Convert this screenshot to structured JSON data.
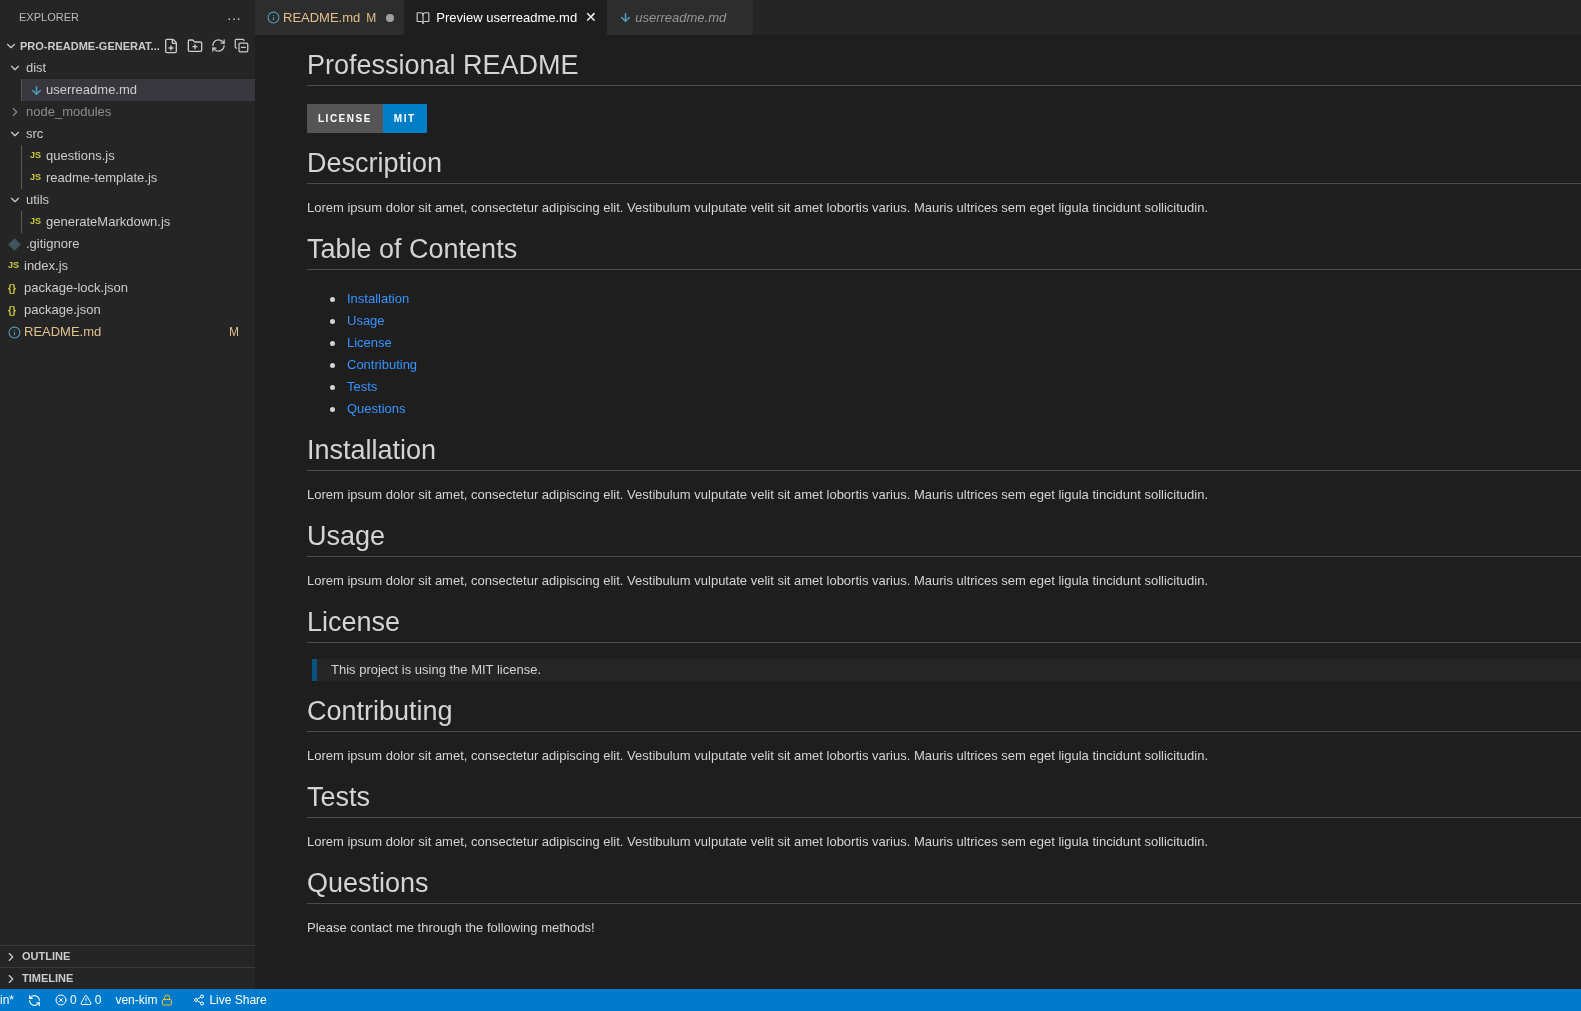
{
  "sidebar": {
    "title": "EXPLORER",
    "menu": "···",
    "root": {
      "label": "PRO-README-GENERAT...",
      "expanded": true
    },
    "tree": [
      {
        "label": "dist",
        "kind": "folder",
        "expanded": true,
        "children": [
          {
            "label": "userreadme.md",
            "kind": "md",
            "selected": true
          }
        ]
      },
      {
        "label": "node_modules",
        "kind": "folder",
        "expanded": false,
        "ignored": true
      },
      {
        "label": "src",
        "kind": "folder",
        "expanded": true,
        "children": [
          {
            "label": "questions.js",
            "kind": "js",
            "icon": "JS",
            "selected": false
          },
          {
            "label": "readme-template.js",
            "kind": "js",
            "icon": "JS",
            "selected": false
          }
        ]
      },
      {
        "label": "utils",
        "kind": "folder",
        "expanded": true,
        "children": [
          {
            "label": "generateMarkdown.js",
            "kind": "js",
            "icon": "JS",
            "selected": false
          }
        ]
      },
      {
        "label": ".gitignore",
        "kind": "git",
        "selected": false
      },
      {
        "label": "index.js",
        "kind": "js",
        "icon": "JS",
        "selected": false
      },
      {
        "label": "package-lock.json",
        "kind": "json",
        "icon": "{}",
        "selected": false
      },
      {
        "label": "package.json",
        "kind": "json",
        "icon": "{}",
        "selected": false
      },
      {
        "label": "README.md",
        "kind": "info",
        "selected": false,
        "badge": "M"
      }
    ],
    "panels": [
      {
        "label": "OUTLINE",
        "expanded": false
      },
      {
        "label": "TIMELINE",
        "expanded": false
      }
    ]
  },
  "tabs": [
    {
      "label": "README.md",
      "kind": "info",
      "badge": "M",
      "dirty": true,
      "italic": false,
      "selected": false
    },
    {
      "label": "Preview userreadme.md",
      "kind": "preview",
      "close": "✕",
      "dirty": false,
      "italic": false,
      "selected": true
    },
    {
      "label": "userreadme.md",
      "kind": "md",
      "dirty": false,
      "italic": true,
      "selected": false
    }
  ],
  "preview": {
    "title": "Professional README",
    "badge": {
      "label": "LICENSE",
      "value": "MIT"
    },
    "sections": [
      {
        "heading": "Description",
        "kind": "paragraph",
        "text": "Lorem ipsum dolor sit amet, consectetur adipiscing elit. Vestibulum vulputate velit sit amet lobortis varius. Mauris ultrices sem eget ligula tincidunt sollicitudin."
      },
      {
        "heading": "Table of Contents",
        "kind": "links",
        "items": [
          "Installation",
          "Usage",
          "License",
          "Contributing",
          "Tests",
          "Questions"
        ]
      },
      {
        "heading": "Installation",
        "kind": "paragraph",
        "text": "Lorem ipsum dolor sit amet, consectetur adipiscing elit. Vestibulum vulputate velit sit amet lobortis varius. Mauris ultrices sem eget ligula tincidunt sollicitudin."
      },
      {
        "heading": "Usage",
        "kind": "paragraph",
        "text": "Lorem ipsum dolor sit amet, consectetur adipiscing elit. Vestibulum vulputate velit sit amet lobortis varius. Mauris ultrices sem eget ligula tincidunt sollicitudin."
      },
      {
        "heading": "License",
        "kind": "quote",
        "text": "This project is using the MIT license."
      },
      {
        "heading": "Contributing",
        "kind": "paragraph",
        "text": "Lorem ipsum dolor sit amet, consectetur adipiscing elit. Vestibulum vulputate velit sit amet lobortis varius. Mauris ultrices sem eget ligula tincidunt sollicitudin."
      },
      {
        "heading": "Tests",
        "kind": "paragraph",
        "text": "Lorem ipsum dolor sit amet, consectetur adipiscing elit. Vestibulum vulputate velit sit amet lobortis varius. Mauris ultrices sem eget ligula tincidunt sollicitudin."
      },
      {
        "heading": "Questions",
        "kind": "paragraph",
        "text": "Please contact me through the following methods!"
      }
    ]
  },
  "status_bar": {
    "branch": "in*",
    "errors": "0",
    "warnings": "0",
    "account": "ven-kim",
    "live_share": "Live Share"
  }
}
